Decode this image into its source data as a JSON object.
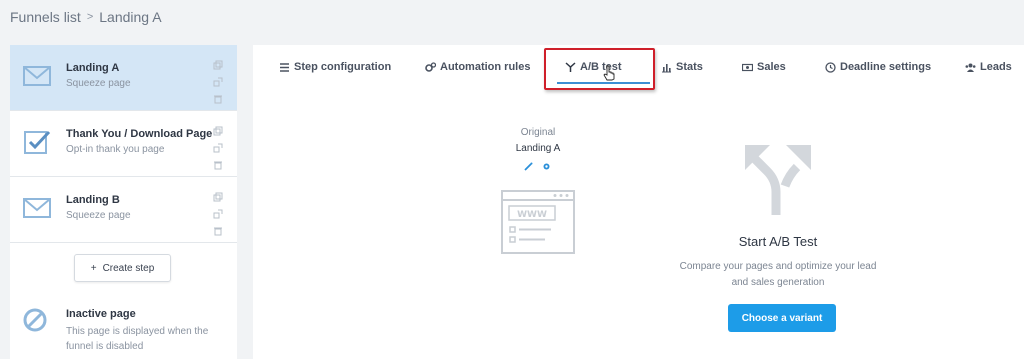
{
  "breadcrumb": {
    "parent": "Funnels list",
    "separator": ">",
    "current": "Landing A"
  },
  "sidebar": {
    "steps": [
      {
        "title": "Landing A",
        "subtitle": "Squeeze page",
        "icon": "envelope-icon",
        "active": true
      },
      {
        "title": "Thank You / Download Page",
        "subtitle": "Opt-in thank you page",
        "icon": "checkbox-icon",
        "active": false
      },
      {
        "title": "Landing B",
        "subtitle": "Squeeze page",
        "icon": "envelope-icon",
        "active": false
      }
    ],
    "create_step": {
      "icon": "+",
      "label": "Create step"
    },
    "inactive": {
      "title": "Inactive page",
      "description": "This page is displayed when the funnel is disabled",
      "icon": "ban-icon"
    }
  },
  "tabs": [
    {
      "label": "Step configuration",
      "icon": "list-icon"
    },
    {
      "label": "Automation rules",
      "icon": "gears-icon"
    },
    {
      "label": "A/B test",
      "icon": "split-icon",
      "active": true
    },
    {
      "label": "Stats",
      "icon": "bar-chart-icon"
    },
    {
      "label": "Sales",
      "icon": "money-icon"
    },
    {
      "label": "Deadline settings",
      "icon": "clock-icon"
    },
    {
      "label": "Leads",
      "icon": "users-icon"
    }
  ],
  "original": {
    "label": "Original",
    "name": "Landing A",
    "preview_text": "WWW"
  },
  "ab_test": {
    "title": "Start A/B Test",
    "description": "Compare your pages and optimize your lead and sales generation",
    "button_label": "Choose a variant"
  },
  "colors": {
    "accent": "#1d9ce8",
    "active_step_bg": "#d4e6f6",
    "tab_underline": "#3c8fd4",
    "highlight": "#cf1f2a"
  }
}
